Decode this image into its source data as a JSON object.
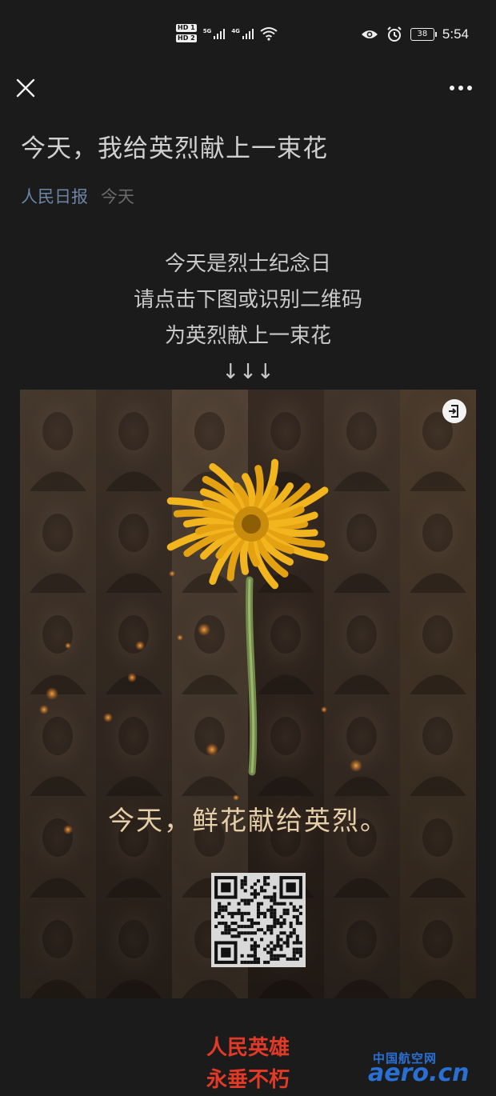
{
  "status_bar": {
    "hd1": "HD 1",
    "hd2": "HD 2",
    "signal1": "5G",
    "signal2": "4G",
    "battery": "38",
    "time": "5:54"
  },
  "article": {
    "title": "今天，我给英烈献上一束花",
    "account": "人民日报",
    "date": "今天"
  },
  "intro": [
    "今天是烈士纪念日",
    "请点击下图或识别二维码",
    "为英烈献上一束花",
    "↓↓↓"
  ],
  "poster": {
    "caption": "今天，鲜花献给英烈。"
  },
  "footer": [
    "人民英雄",
    "永垂不朽"
  ],
  "watermark": {
    "cn": "中国航空网",
    "en": "aero.cn"
  },
  "colors": {
    "background": "#1b1b1b",
    "account_link": "#6c85a6",
    "footer_red": "#e23a27",
    "flower_yellow": "#f2b51e",
    "caption_gold": "#e6cfa8"
  }
}
